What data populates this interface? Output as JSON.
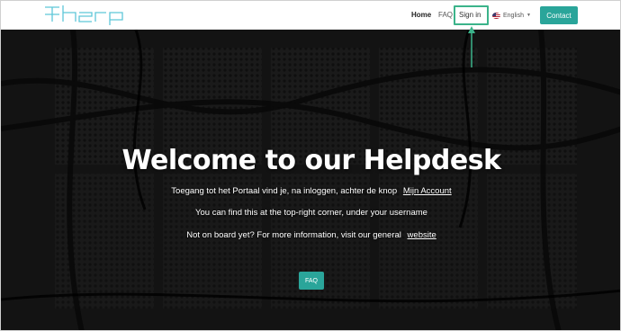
{
  "nav": {
    "logo_text": "therp",
    "home": "Home",
    "faq": "FAQ",
    "signin": "Sign in",
    "language": "English",
    "contact": "Contact"
  },
  "hero": {
    "title": "Welcome to our Helpdesk",
    "line1_text": "Toegang tot het Portaal vind je, na inloggen, achter de knop",
    "line1_link": "Mijn Account",
    "line2_text": "You can find this at the top-right corner, under your username",
    "line3_text": "Not on board yet? For more information, visit our general",
    "line3_link": "website",
    "faq_button": "FAQ"
  },
  "colors": {
    "accent": "#2aa59a",
    "highlight_box": "#3bb38a",
    "logo": "#5ec6d8"
  },
  "icons": {
    "flag": "us-flag-icon",
    "caret": "caret-down-icon",
    "arrow": "arrow-up-icon"
  }
}
